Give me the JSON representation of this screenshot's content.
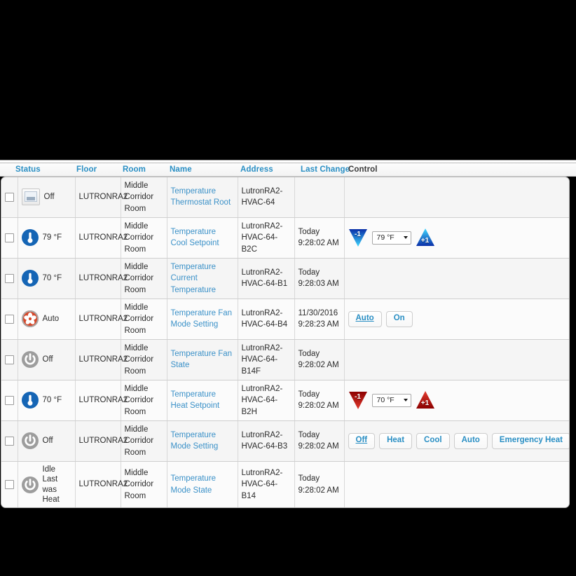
{
  "table": {
    "columns": [
      {
        "key": "checkbox",
        "label": "",
        "sortable": false
      },
      {
        "key": "status",
        "label": "Status",
        "sortable": true
      },
      {
        "key": "floor",
        "label": "Floor",
        "sortable": true
      },
      {
        "key": "room",
        "label": "Room",
        "sortable": true
      },
      {
        "key": "name",
        "label": "Name",
        "sortable": true
      },
      {
        "key": "address",
        "label": "Address",
        "sortable": true
      },
      {
        "key": "last_change",
        "label": "Last Change",
        "sortable": true
      },
      {
        "key": "control",
        "label": "Control",
        "sortable": false
      }
    ],
    "rows": [
      {
        "icon": "thermostat-device-icon",
        "status": "Off",
        "floor": "LUTRONRA2",
        "room": "Middle Corridor Room",
        "name": "Temperature Thermostat Root",
        "address": "LutronRA2-HVAC-64",
        "last_change": "",
        "control": {
          "type": "none"
        }
      },
      {
        "icon": "thermometer-icon",
        "status": "79 °F",
        "floor": "LUTRONRA2",
        "room": "Middle Corridor Room",
        "name": "Temperature Cool Setpoint",
        "address": "LutronRA2-HVAC-64-B2C",
        "last_change": "Today 9:28:02 AM",
        "control": {
          "type": "stepper",
          "color": "#0b63d6",
          "decrement_label": "-1",
          "increment_label": "+1",
          "value": "79 °F"
        }
      },
      {
        "icon": "thermometer-icon",
        "status": "70 °F",
        "floor": "LUTRONRA2",
        "room": "Middle Corridor Room",
        "name": "Temperature Current Temperature",
        "address": "LutronRA2-HVAC-64-B1",
        "last_change": "Today 9:28:03 AM",
        "control": {
          "type": "none"
        }
      },
      {
        "icon": "fan-icon",
        "status": "Auto",
        "floor": "LUTRONRA2",
        "room": "Middle Corridor Room",
        "name": "Temperature Fan Mode Setting",
        "address": "LutronRA2-HVAC-64-B4",
        "last_change": "11/30/2016 9:28:23 AM",
        "control": {
          "type": "buttons",
          "buttons": [
            {
              "label": "Auto",
              "active": true
            },
            {
              "label": "On",
              "active": false
            }
          ]
        }
      },
      {
        "icon": "power-icon",
        "status": "Off",
        "floor": "LUTRONRA2",
        "room": "Middle Corridor Room",
        "name": "Temperature Fan State",
        "address": "LutronRA2-HVAC-64-B14F",
        "last_change": "Today 9:28:02 AM",
        "control": {
          "type": "none"
        }
      },
      {
        "icon": "thermometer-icon",
        "status": "70 °F",
        "floor": "LUTRONRA2",
        "room": "Middle Corridor Room",
        "name": "Temperature Heat Setpoint",
        "address": "LutronRA2-HVAC-64-B2H",
        "last_change": "Today 9:28:02 AM",
        "control": {
          "type": "stepper",
          "color": "#c00000",
          "decrement_label": "-1",
          "increment_label": "+1",
          "value": "70 °F"
        }
      },
      {
        "icon": "power-icon",
        "status": "Off",
        "floor": "LUTRONRA2",
        "room": "Middle Corridor Room",
        "name": "Temperature Mode Setting",
        "address": "LutronRA2-HVAC-64-B3",
        "last_change": "Today 9:28:02 AM",
        "control": {
          "type": "buttons",
          "buttons": [
            {
              "label": "Off",
              "active": true
            },
            {
              "label": "Heat",
              "active": false
            },
            {
              "label": "Cool",
              "active": false
            },
            {
              "label": "Auto",
              "active": false
            },
            {
              "label": "Emergency Heat",
              "active": false
            }
          ]
        }
      },
      {
        "icon": "power-icon",
        "status": "Idle Last was Heat",
        "floor": "LUTRONRA2",
        "room": "Middle Corridor Room",
        "name": "Temperature Mode State",
        "address": "LutronRA2-HVAC-64-B14",
        "last_change": "Today 9:28:02 AM",
        "control": {
          "type": "none"
        }
      }
    ]
  },
  "colors": {
    "header_link": "#2a8fc4",
    "header_plain": "#3a3a3a",
    "row_link": "#3b91c8",
    "cool_accent": "#0b63d6",
    "heat_accent": "#c00000"
  }
}
